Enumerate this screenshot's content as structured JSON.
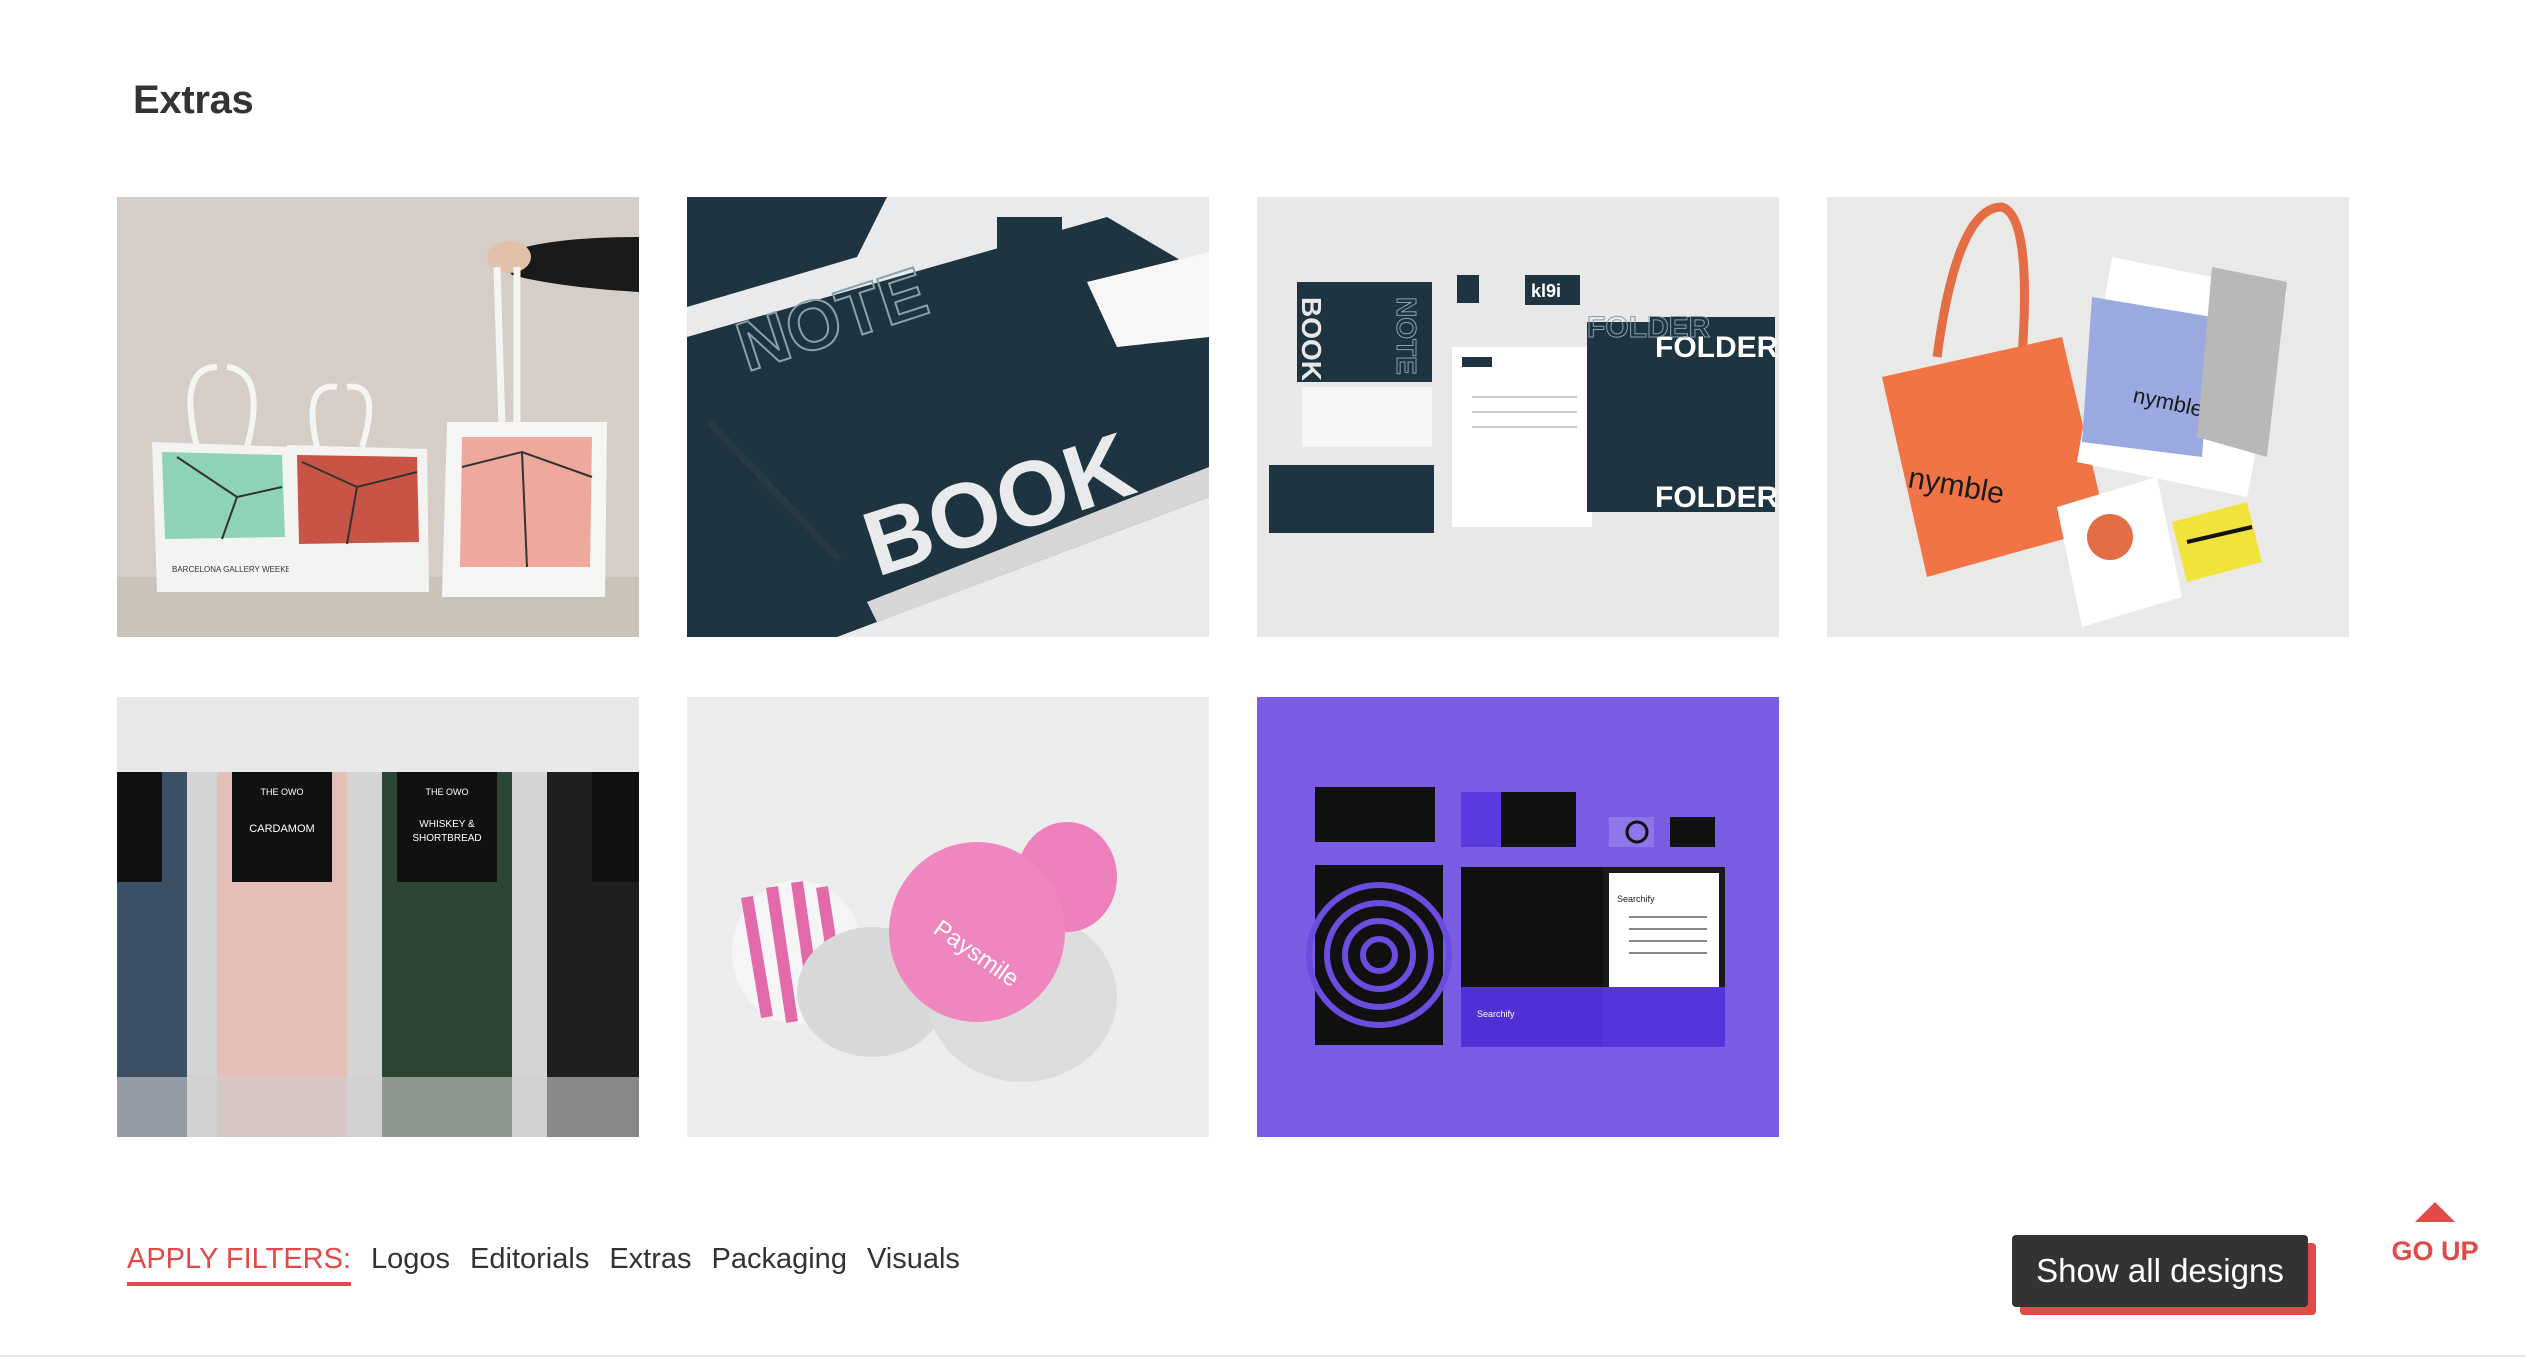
{
  "section": {
    "title": "Extras"
  },
  "gallery": {
    "items": [
      {
        "label": "Barcelona gallery weekend tote bags",
        "bag_text": "BARCELONA GALLERY WEEKEND"
      },
      {
        "label": "Notebook stationery mockup",
        "word_note": "NOTE",
        "word_book": "BOOK"
      },
      {
        "label": "Stationery set with folders",
        "word_book": "BOOK",
        "word_note": "NOTE",
        "word_folder": "FOLDER",
        "brand": "kl9i"
      },
      {
        "label": "Nymble tote and cards",
        "brand": "nymble"
      },
      {
        "label": "The Owo chocolate packaging",
        "brand": "THE OWO",
        "flavor_1": "CARDAMOM",
        "flavor_2": "WHISKEY &",
        "flavor_2b": "SHORTBREAD"
      },
      {
        "label": "Paysmile pin badges",
        "brand": "Paysmile"
      },
      {
        "label": "Searchify stationery on purple",
        "brand": "Searchify"
      }
    ]
  },
  "filters": {
    "apply_label": "APPLY FILTERS:",
    "items": [
      "Logos",
      "Editorials",
      "Extras",
      "Packaging",
      "Visuals"
    ]
  },
  "show_all_label": "Show all designs",
  "go_up_label": "GO UP",
  "colors": {
    "accent": "#e04a48",
    "dark_button": "#333333",
    "navy": "#1e3441",
    "purple": "#7b5ce5"
  }
}
